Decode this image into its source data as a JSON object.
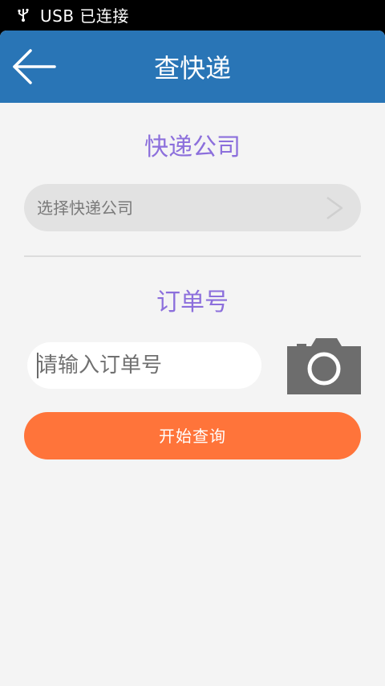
{
  "status_bar": {
    "usb_icon": "usb-icon",
    "text": "USB 已连接"
  },
  "header": {
    "back_icon": "arrow-left-icon",
    "title": "查快递",
    "background": "#2975b6"
  },
  "company_section": {
    "title": "快递公司",
    "select_placeholder": "选择快递公司",
    "chevron_icon": "chevron-right-icon"
  },
  "order_section": {
    "title": "订单号",
    "input_value": "",
    "input_placeholder": "请输入订单号",
    "camera_icon": "camera-icon"
  },
  "actions": {
    "start_label": "开始查询",
    "start_color": "#ff743a"
  },
  "colors": {
    "section_title": "#8c6fdc",
    "page_background": "#f4f4f4"
  }
}
